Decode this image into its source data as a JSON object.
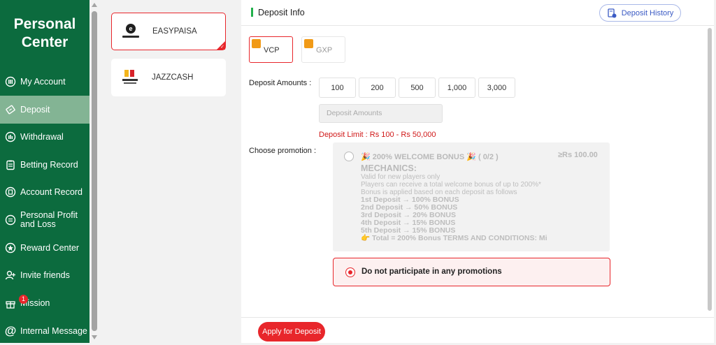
{
  "sidebar": {
    "title_line1": "Personal",
    "title_line2": "Center",
    "items": [
      {
        "label": "My Account",
        "icon": "account-icon"
      },
      {
        "label": "Deposit",
        "icon": "deposit-icon"
      },
      {
        "label": "Withdrawal",
        "icon": "withdrawal-icon"
      },
      {
        "label": "Betting Record",
        "icon": "betting-record-icon"
      },
      {
        "label": "Account Record",
        "icon": "account-record-icon"
      },
      {
        "label": "Personal Profit and Loss",
        "icon": "profit-loss-icon"
      },
      {
        "label": "Reward Center",
        "icon": "reward-icon"
      },
      {
        "label": "Invite friends",
        "icon": "invite-icon"
      },
      {
        "label": "Mission",
        "icon": "gift-icon",
        "badge": "1"
      },
      {
        "label": "Internal Message",
        "icon": "at-icon"
      }
    ],
    "active": "Deposit"
  },
  "methods": [
    {
      "name": "EASYPAISA",
      "selected": true
    },
    {
      "name": "JAZZCASH",
      "selected": false
    }
  ],
  "header": {
    "title": "Deposit Info",
    "history_button": "Deposit History"
  },
  "currencies": [
    {
      "name": "VCP",
      "selected": true
    },
    {
      "name": "GXP",
      "selected": false
    }
  ],
  "deposit": {
    "amounts_label": "Deposit Amounts :",
    "amounts": [
      "100",
      "200",
      "500",
      "1,000",
      "3,000"
    ],
    "input_placeholder": "Deposit Amounts",
    "limit_text": "Deposit Limit :  Rs  100  -  Rs  50,000"
  },
  "promotion": {
    "label": "Choose promotion :",
    "title": "🎉 200% WELCOME BONUS 🎉 ( 0/2 )",
    "min": "≥Rs  100.00",
    "mechanics_heading": "MECHANICS:",
    "lines": [
      "Valid for new players only",
      "Players can receive a total welcome bonus of up to 200%*",
      "Bonus is applied based on each deposit as follows",
      "1st Deposit → 100% BONUS",
      "2nd Deposit → 50% BONUS",
      "3rd Deposit → 20% BONUS",
      "4th Deposit → 15% BONUS",
      "5th Deposit → 15% BONUS",
      "👉 Total = 200% Bonus TERMS AND CONDITIONS: Mi"
    ],
    "no_promo": "Do not participate in any promotions"
  },
  "footer": {
    "apply_button": "Apply for Deposit"
  },
  "colors": {
    "sidebar_bg": "#0c6b3e",
    "accent_red": "#e8262b",
    "header_accent": "#22b14c",
    "history_blue": "#3b5bc4"
  }
}
